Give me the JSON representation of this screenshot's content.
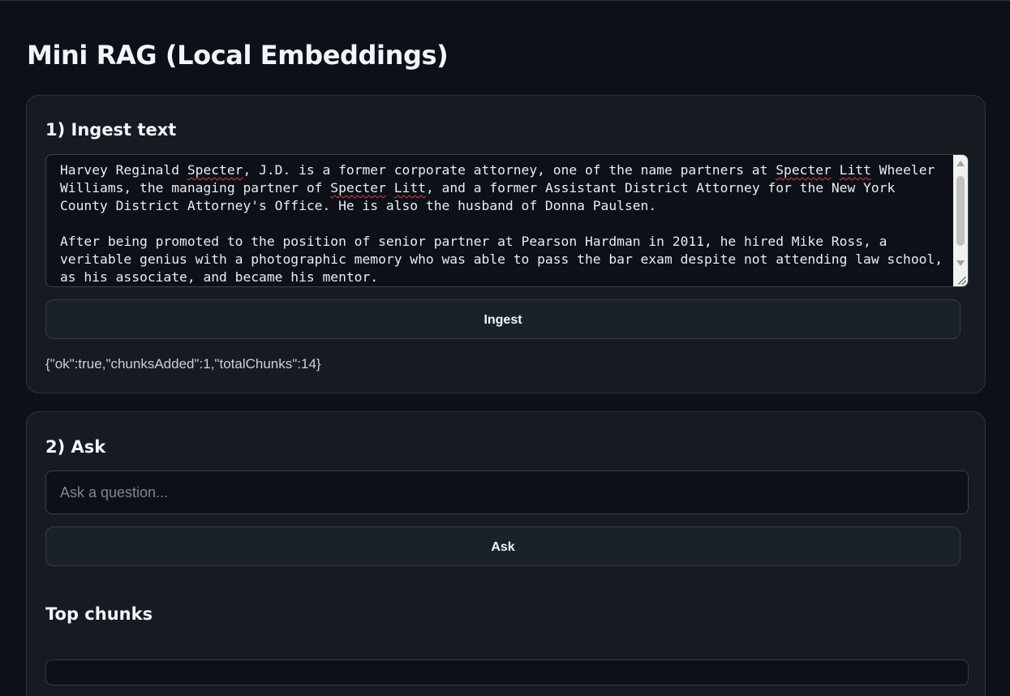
{
  "page": {
    "title": "Mini RAG (Local Embeddings)"
  },
  "ingest": {
    "heading": "1) Ingest text",
    "textarea_paragraphs": [
      [
        {
          "t": "Harvey Reginald "
        },
        {
          "t": "Specter",
          "spell": true
        },
        {
          "t": ", J.D. is a former corporate attorney, one of the name partners at "
        },
        {
          "t": "Specter",
          "spell": true
        },
        {
          "t": " "
        },
        {
          "t": "Litt",
          "spell": true
        },
        {
          "t": " Wheeler Williams, the managing partner of "
        },
        {
          "t": "Specter",
          "spell": true
        },
        {
          "t": " "
        },
        {
          "t": "Litt",
          "spell": true
        },
        {
          "t": ", and a former Assistant District Attorney for the New York County District Attorney's Office. He is also the husband of Donna Paulsen."
        }
      ],
      [
        {
          "t": "After being promoted to the position of senior partner at Pearson Hardman in 2011, he hired Mike Ross, a veritable genius with a photographic memory who was able to pass the bar exam despite not attending law school, as his associate, and became his mentor."
        }
      ]
    ],
    "button_label": "Ingest",
    "status": "{\"ok\":true,\"chunksAdded\":1,\"totalChunks\":14}"
  },
  "ask": {
    "heading": "2) Ask",
    "input_value": "",
    "input_placeholder": "Ask a question...",
    "button_label": "Ask",
    "top_chunks_heading": "Top chunks"
  },
  "colors": {
    "background": "#0d1117",
    "card": "#161b22",
    "spellcheck_underline": "#e0393e"
  }
}
